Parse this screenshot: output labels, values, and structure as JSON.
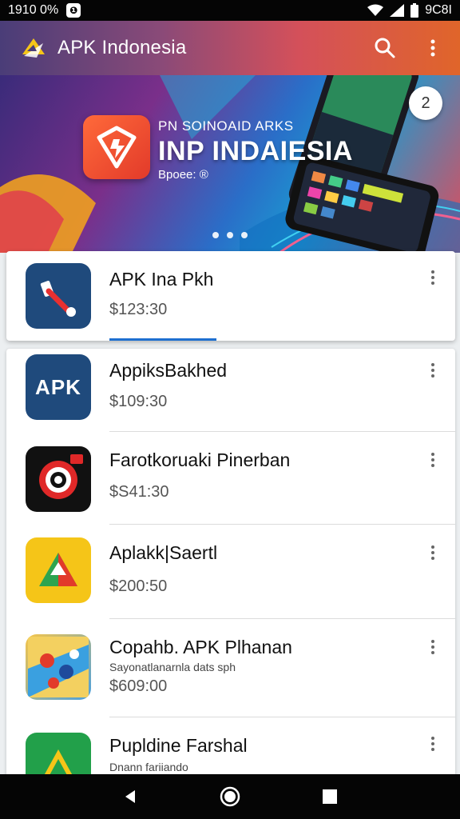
{
  "status_bar": {
    "time": "1910 0%",
    "badge": "❶",
    "right_text": "9C8I"
  },
  "app_bar": {
    "title": "APK Indonesia",
    "search_icon": "search-icon",
    "more_icon": "more-vert-icon"
  },
  "banner": {
    "subtitle": "PN SOINOAID ARKS",
    "title": "INP INDAIESIA",
    "tag": "Bpoee: ®",
    "counter": "2",
    "dots": 3
  },
  "featured": {
    "title": "APK Ina Pkh",
    "price": "$123:30"
  },
  "apps": [
    {
      "title": "AppiksBakhed",
      "price": "$109:30",
      "icon": "apk-text-icon"
    },
    {
      "title": "Farotkoruaki Pinerban",
      "price": "$S41:30",
      "icon": "red-target-icon"
    },
    {
      "title": "Aplakk|Saertl",
      "price": "$200:50",
      "icon": "triangle-play-icon"
    },
    {
      "title": "Copahb. APK Plhanan",
      "subtitle": "Sayonatlanarnla dats sph",
      "price": "$609:00",
      "icon": "map-pins-icon"
    },
    {
      "title": "Pupldine Farshal",
      "subtitle": "Dnann fariiando",
      "icon": "green-triangle-icon"
    }
  ],
  "colors": {
    "accent": "#1e6fd0",
    "app_bar_start": "#4a3d78",
    "app_bar_end": "#e0652a"
  },
  "nav": {
    "back": "back-icon",
    "home": "home-icon",
    "recents": "recents-icon"
  }
}
